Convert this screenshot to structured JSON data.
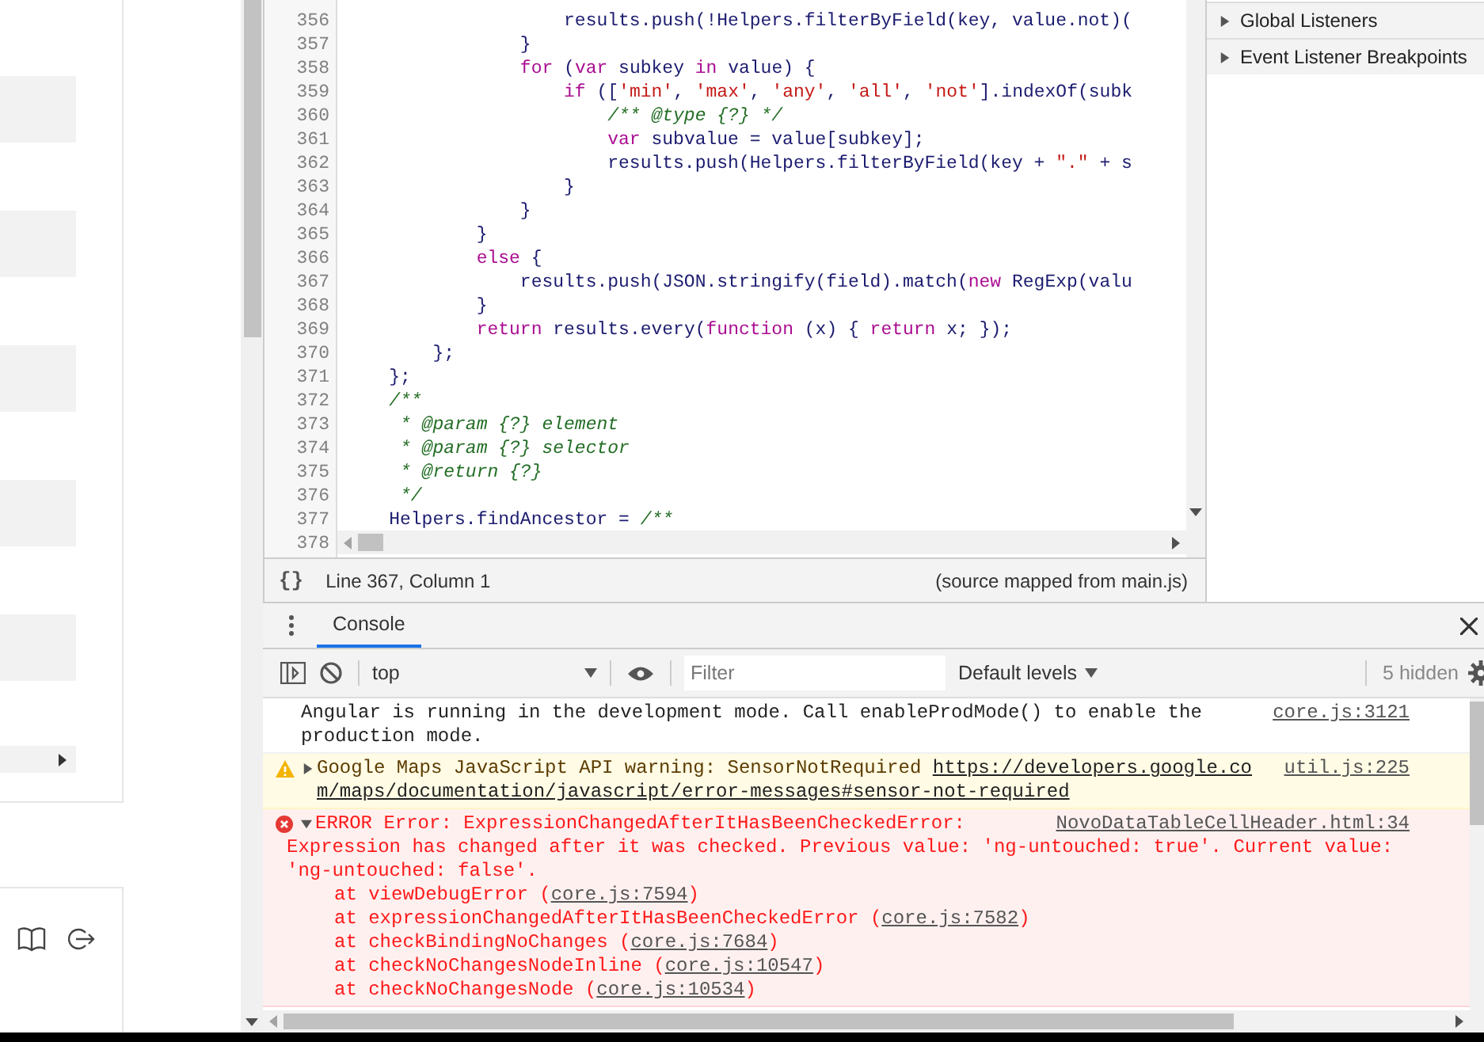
{
  "editor": {
    "lines": [
      {
        "number": "356",
        "tokens": [
          {
            "kind": "code",
            "text": "                    results.push(!Helpers.filterByField(key, value.not)("
          }
        ]
      },
      {
        "number": "357",
        "tokens": [
          {
            "kind": "code",
            "text": "                }"
          }
        ]
      },
      {
        "number": "358",
        "tokens": [
          {
            "kind": "keyword",
            "text": "                for"
          },
          {
            "kind": "code",
            "text": " ("
          },
          {
            "kind": "keyword",
            "text": "var"
          },
          {
            "kind": "code",
            "text": " subkey "
          },
          {
            "kind": "keyword",
            "text": "in"
          },
          {
            "kind": "code",
            "text": " value) {"
          }
        ]
      },
      {
        "number": "359",
        "tokens": [
          {
            "kind": "keyword",
            "text": "                    if"
          },
          {
            "kind": "code",
            "text": " (["
          },
          {
            "kind": "string",
            "text": "'min'"
          },
          {
            "kind": "code",
            "text": ", "
          },
          {
            "kind": "string",
            "text": "'max'"
          },
          {
            "kind": "code",
            "text": ", "
          },
          {
            "kind": "string",
            "text": "'any'"
          },
          {
            "kind": "code",
            "text": ", "
          },
          {
            "kind": "string",
            "text": "'all'"
          },
          {
            "kind": "code",
            "text": ", "
          },
          {
            "kind": "string",
            "text": "'not'"
          },
          {
            "kind": "code",
            "text": "].indexOf(subk"
          }
        ]
      },
      {
        "number": "360",
        "tokens": [
          {
            "kind": "comment",
            "text": "                        /** @type {?} */"
          }
        ]
      },
      {
        "number": "361",
        "tokens": [
          {
            "kind": "keyword",
            "text": "                        var"
          },
          {
            "kind": "code",
            "text": " subvalue = value[subkey];"
          }
        ]
      },
      {
        "number": "362",
        "tokens": [
          {
            "kind": "code",
            "text": "                        results.push(Helpers.filterByField(key + "
          },
          {
            "kind": "string",
            "text": "\".\""
          },
          {
            "kind": "code",
            "text": " + s"
          }
        ]
      },
      {
        "number": "363",
        "tokens": [
          {
            "kind": "code",
            "text": "                    }"
          }
        ]
      },
      {
        "number": "364",
        "tokens": [
          {
            "kind": "code",
            "text": "                }"
          }
        ]
      },
      {
        "number": "365",
        "tokens": [
          {
            "kind": "code",
            "text": "            }"
          }
        ]
      },
      {
        "number": "366",
        "tokens": [
          {
            "kind": "keyword",
            "text": "            else"
          },
          {
            "kind": "code",
            "text": " {"
          }
        ]
      },
      {
        "number": "367",
        "tokens": [
          {
            "kind": "code",
            "text": "                results.push(JSON.stringify(field).match("
          },
          {
            "kind": "keyword",
            "text": "new"
          },
          {
            "kind": "code",
            "text": " RegExp(valu"
          }
        ]
      },
      {
        "number": "368",
        "tokens": [
          {
            "kind": "code",
            "text": "            }"
          }
        ]
      },
      {
        "number": "369",
        "tokens": [
          {
            "kind": "keyword",
            "text": "            return"
          },
          {
            "kind": "code",
            "text": " results.every("
          },
          {
            "kind": "keyword",
            "text": "function"
          },
          {
            "kind": "code",
            "text": " (x) { "
          },
          {
            "kind": "keyword",
            "text": "return"
          },
          {
            "kind": "code",
            "text": " x; });"
          }
        ]
      },
      {
        "number": "370",
        "tokens": [
          {
            "kind": "code",
            "text": "        };"
          }
        ]
      },
      {
        "number": "371",
        "tokens": [
          {
            "kind": "code",
            "text": "    };"
          }
        ]
      },
      {
        "number": "372",
        "tokens": [
          {
            "kind": "comment",
            "text": "    /**"
          }
        ]
      },
      {
        "number": "373",
        "tokens": [
          {
            "kind": "comment",
            "text": "     * @param {?} element"
          }
        ]
      },
      {
        "number": "374",
        "tokens": [
          {
            "kind": "comment",
            "text": "     * @param {?} selector"
          }
        ]
      },
      {
        "number": "375",
        "tokens": [
          {
            "kind": "comment",
            "text": "     * @return {?}"
          }
        ]
      },
      {
        "number": "376",
        "tokens": [
          {
            "kind": "comment",
            "text": "     */"
          }
        ]
      },
      {
        "number": "377",
        "tokens": [
          {
            "kind": "code",
            "text": "    Helpers.findAncestor = "
          },
          {
            "kind": "comment",
            "text": "/**"
          }
        ]
      },
      {
        "number": "378"
      }
    ],
    "status": {
      "format_button": "{}",
      "position": "Line 367, Column 1",
      "source_map": "(source mapped from main.js)"
    }
  },
  "sidebar": {
    "sections": [
      {
        "label": "Global Listeners",
        "expanded": false
      },
      {
        "label": "Event Listener Breakpoints",
        "expanded": false
      }
    ]
  },
  "drawer": {
    "tabs": [
      {
        "label": "Console",
        "selected": true
      }
    ],
    "toolbar": {
      "context": "top",
      "filter_placeholder": "Filter",
      "levels": "Default levels",
      "hidden": "5 hidden"
    },
    "messages": [
      {
        "kind": "info",
        "text": "Angular is running in the development mode. Call enableProdMode() to enable the production mode.",
        "source": "core.js:3121"
      },
      {
        "kind": "warning",
        "expanded": false,
        "text": "Google Maps JavaScript API warning: SensorNotRequired",
        "link": "https://developers.google.com/maps/documentation/javascript/error-messages#sensor-not-required",
        "source": "util.js:225"
      },
      {
        "kind": "error",
        "expanded": true,
        "text": "ERROR Error: ExpressionChangedAfterItHasBeenCheckedError:",
        "detail": "Expression has changed after it was checked. Previous value: 'ng-untouched: true'. Current value: 'ng-untouched: false'.",
        "source": "NovoDataTableCellHeader.html:34",
        "stack": [
          {
            "call": "at viewDebugError (",
            "location": "core.js:7594",
            "close": ")"
          },
          {
            "call": "at expressionChangedAfterItHasBeenCheckedError (",
            "location": "core.js:7582",
            "close": ")"
          },
          {
            "call": "at checkBindingNoChanges (",
            "location": "core.js:7684",
            "close": ")"
          },
          {
            "call": "at checkNoChangesNodeInline (",
            "location": "core.js:10547",
            "close": ")"
          },
          {
            "call": "at checkNoChangesNode (",
            "location": "core.js:10534",
            "close": ")"
          }
        ]
      }
    ]
  }
}
